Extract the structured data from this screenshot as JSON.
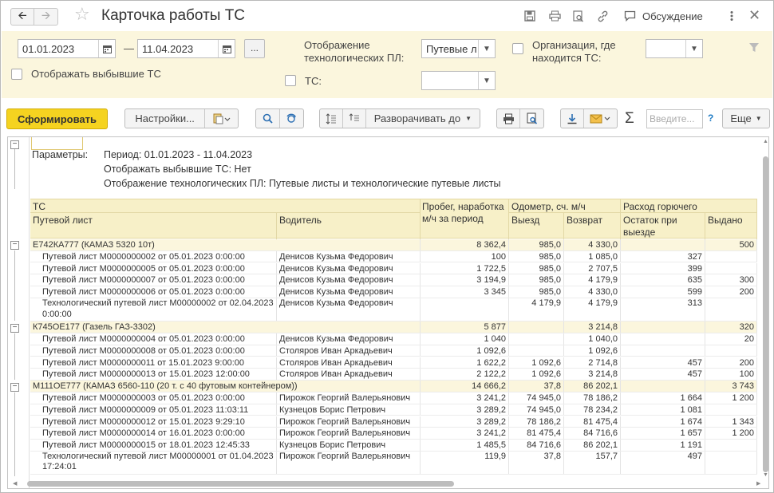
{
  "window": {
    "title": "Карточка работы ТС",
    "discussion_label": "Обсуждение"
  },
  "params": {
    "date_from": "01.01.2023",
    "dash": "—",
    "date_to": "11.04.2023",
    "dots": "...",
    "show_retired_label": "Отображать выбывшие ТС",
    "tech_display_label": "Отображение технологических ПЛ:",
    "tech_display_value": "Путевые л",
    "org_label": "Организация, где находится ТС:",
    "org_value": "",
    "ts_label": "ТС:",
    "ts_value": ""
  },
  "toolbar": {
    "generate": "Сформировать",
    "settings": "Настройки...",
    "expand_to": "Разворачивать до",
    "enter_placeholder": "Введите...",
    "help": "?",
    "more": "Еще"
  },
  "report": {
    "params_label": "Параметры:",
    "params_lines": [
      "Период: 01.01.2023 - 11.04.2023",
      "Отображать выбывшие ТС: Нет",
      "Отображение технологических ПЛ: Путевые листы и технологические путевые листы"
    ],
    "headers": {
      "ts": "ТС",
      "waybill": "Путевой лист",
      "driver": "Водитель",
      "mileage": "Пробег, наработка м/ч за период",
      "odometer": "Одометр, сч. м/ч",
      "departure": "Выезд",
      "return": "Возврат",
      "fuel": "Расход горючего",
      "fuel_left": "Остаток при выезде",
      "fuel_issued": "Выдано"
    },
    "rows": [
      {
        "type": "group",
        "name": "Е742КА777 (КАМАЗ 5320 10т)",
        "mileage": "8 362,4",
        "dep": "985,0",
        "ret": "4 330,0",
        "left": "",
        "issued": "500"
      },
      {
        "type": "item",
        "name": "Путевой лист М0000000002 от 05.01.2023 0:00:00",
        "driver": "Денисов Кузьма Федорович",
        "mileage": "100",
        "dep": "985,0",
        "ret": "1 085,0",
        "left": "327",
        "issued": ""
      },
      {
        "type": "item",
        "name": "Путевой лист М0000000005 от 05.01.2023 0:00:00",
        "driver": "Денисов Кузьма Федорович",
        "mileage": "1 722,5",
        "dep": "985,0",
        "ret": "2 707,5",
        "left": "399",
        "issued": ""
      },
      {
        "type": "item",
        "name": "Путевой лист М0000000007 от 05.01.2023 0:00:00",
        "driver": "Денисов Кузьма Федорович",
        "mileage": "3 194,9",
        "dep": "985,0",
        "ret": "4 179,9",
        "left": "635",
        "issued": "300"
      },
      {
        "type": "item",
        "name": "Путевой лист М0000000006 от 05.01.2023 0:00:00",
        "driver": "Денисов Кузьма Федорович",
        "mileage": "3 345",
        "dep": "985,0",
        "ret": "4 330,0",
        "left": "599",
        "issued": "200"
      },
      {
        "type": "tall",
        "name": "Технологический путевой лист М00000002 от 02.04.2023 0:00:00",
        "driver": "Денисов Кузьма Федорович",
        "mileage": "",
        "dep": "4 179,9",
        "ret": "4 179,9",
        "left": "313",
        "issued": ""
      },
      {
        "type": "group",
        "name": "К745ОЕ177 (Газель ГАЗ-3302)",
        "mileage": "5 877",
        "dep": "",
        "ret": "3 214,8",
        "left": "",
        "issued": "320"
      },
      {
        "type": "item",
        "name": "Путевой лист М0000000004 от 05.01.2023 0:00:00",
        "driver": "Денисов Кузьма Федорович",
        "mileage": "1 040",
        "dep": "",
        "ret": "1 040,0",
        "left": "",
        "issued": "20"
      },
      {
        "type": "item",
        "name": "Путевой лист М0000000008 от 05.01.2023 0:00:00",
        "driver": "Столяров Иван Аркадьевич",
        "mileage": "1 092,6",
        "dep": "",
        "ret": "1 092,6",
        "left": "",
        "issued": ""
      },
      {
        "type": "item",
        "name": "Путевой лист М0000000011 от 15.01.2023 9:00:00",
        "driver": "Столяров Иван Аркадьевич",
        "mileage": "1 622,2",
        "dep": "1 092,6",
        "ret": "2 714,8",
        "left": "457",
        "issued": "200"
      },
      {
        "type": "item",
        "name": "Путевой лист М0000000013 от 15.01.2023 12:00:00",
        "driver": "Столяров Иван Аркадьевич",
        "mileage": "2 122,2",
        "dep": "1 092,6",
        "ret": "3 214,8",
        "left": "457",
        "issued": "100"
      },
      {
        "type": "group",
        "name": "М111ОЕ777 (КАМАЗ 6560-110 (20 т. с 40 футовым контейнером))",
        "mileage": "14 666,2",
        "dep": "37,8",
        "ret": "86 202,1",
        "left": "",
        "issued": "3 743"
      },
      {
        "type": "item",
        "name": "Путевой лист М0000000003 от 05.01.2023 0:00:00",
        "driver": "Пирожок Георгий Валерьянович",
        "mileage": "3 241,2",
        "dep": "74 945,0",
        "ret": "78 186,2",
        "left": "1 664",
        "issued": "1 200"
      },
      {
        "type": "item",
        "name": "Путевой лист М0000000009 от 05.01.2023 11:03:11",
        "driver": "Кузнецов Борис Петрович",
        "mileage": "3 289,2",
        "dep": "74 945,0",
        "ret": "78 234,2",
        "left": "1 081",
        "issued": ""
      },
      {
        "type": "item",
        "name": "Путевой лист М0000000012 от 15.01.2023 9:29:10",
        "driver": "Пирожок Георгий Валерьянович",
        "mileage": "3 289,2",
        "dep": "78 186,2",
        "ret": "81 475,4",
        "left": "1 674",
        "issued": "1 343"
      },
      {
        "type": "item",
        "name": "Путевой лист М0000000014 от 16.01.2023 0:00:00",
        "driver": "Пирожок Георгий Валерьянович",
        "mileage": "3 241,2",
        "dep": "81 475,4",
        "ret": "84 716,6",
        "left": "1 657",
        "issued": "1 200"
      },
      {
        "type": "item",
        "name": "Путевой лист М0000000015 от 18.01.2023 12:45:33",
        "driver": "Кузнецов Борис Петрович",
        "mileage": "1 485,5",
        "dep": "84 716,6",
        "ret": "86 202,1",
        "left": "1 191",
        "issued": ""
      },
      {
        "type": "tall",
        "name": "Технологический путевой лист М00000001 от 01.04.2023 17:24:01",
        "driver": "Пирожок Георгий Валерьянович",
        "mileage": "119,9",
        "dep": "37,8",
        "ret": "157,7",
        "left": "497",
        "issued": ""
      }
    ]
  }
}
